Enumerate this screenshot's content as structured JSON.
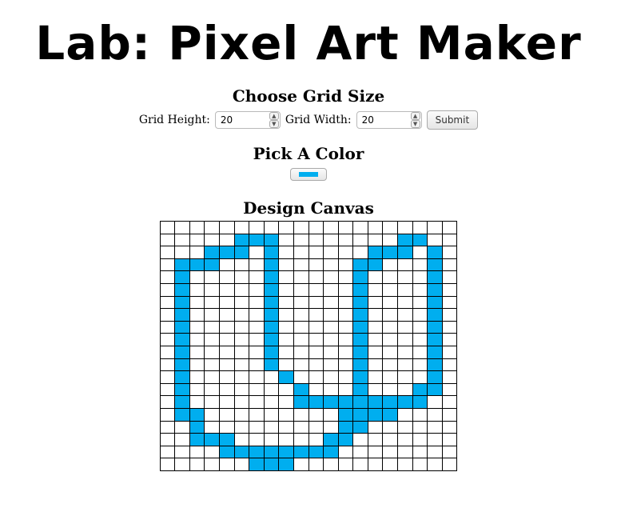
{
  "page": {
    "title": "Lab: Pixel Art Maker"
  },
  "grid_size": {
    "heading": "Choose Grid Size",
    "height_label": "Grid Height:",
    "height_value": "20",
    "width_label": "Grid Width:",
    "width_value": "20",
    "submit_label": "Submit"
  },
  "color": {
    "heading": "Pick A Color",
    "selected": "#00aeef"
  },
  "canvas": {
    "heading": "Design Canvas",
    "rows": 20,
    "cols": 20,
    "empty_color": "#ffffff",
    "fill_color": "#00aeef",
    "filled_cells": [
      [
        1,
        5
      ],
      [
        1,
        6
      ],
      [
        1,
        7
      ],
      [
        1,
        16
      ],
      [
        1,
        17
      ],
      [
        2,
        3
      ],
      [
        2,
        4
      ],
      [
        2,
        5
      ],
      [
        2,
        7
      ],
      [
        2,
        14
      ],
      [
        2,
        15
      ],
      [
        2,
        16
      ],
      [
        2,
        18
      ],
      [
        3,
        1
      ],
      [
        3,
        2
      ],
      [
        3,
        3
      ],
      [
        3,
        7
      ],
      [
        3,
        13
      ],
      [
        3,
        14
      ],
      [
        3,
        18
      ],
      [
        4,
        1
      ],
      [
        4,
        7
      ],
      [
        4,
        13
      ],
      [
        4,
        18
      ],
      [
        5,
        1
      ],
      [
        5,
        7
      ],
      [
        5,
        13
      ],
      [
        5,
        18
      ],
      [
        6,
        1
      ],
      [
        6,
        7
      ],
      [
        6,
        13
      ],
      [
        6,
        18
      ],
      [
        7,
        1
      ],
      [
        7,
        7
      ],
      [
        7,
        13
      ],
      [
        7,
        18
      ],
      [
        8,
        1
      ],
      [
        8,
        7
      ],
      [
        8,
        13
      ],
      [
        8,
        18
      ],
      [
        9,
        1
      ],
      [
        9,
        7
      ],
      [
        9,
        13
      ],
      [
        9,
        18
      ],
      [
        10,
        1
      ],
      [
        10,
        7
      ],
      [
        10,
        13
      ],
      [
        10,
        18
      ],
      [
        11,
        1
      ],
      [
        11,
        7
      ],
      [
        11,
        13
      ],
      [
        11,
        18
      ],
      [
        12,
        1
      ],
      [
        12,
        8
      ],
      [
        12,
        13
      ],
      [
        12,
        18
      ],
      [
        13,
        1
      ],
      [
        13,
        9
      ],
      [
        13,
        13
      ],
      [
        13,
        17
      ],
      [
        13,
        18
      ],
      [
        14,
        1
      ],
      [
        14,
        9
      ],
      [
        14,
        10
      ],
      [
        14,
        11
      ],
      [
        14,
        12
      ],
      [
        14,
        13
      ],
      [
        14,
        14
      ],
      [
        14,
        15
      ],
      [
        14,
        16
      ],
      [
        14,
        17
      ],
      [
        15,
        1
      ],
      [
        15,
        2
      ],
      [
        15,
        12
      ],
      [
        15,
        13
      ],
      [
        15,
        14
      ],
      [
        15,
        15
      ],
      [
        16,
        2
      ],
      [
        16,
        12
      ],
      [
        16,
        13
      ],
      [
        17,
        2
      ],
      [
        17,
        3
      ],
      [
        17,
        4
      ],
      [
        17,
        11
      ],
      [
        17,
        12
      ],
      [
        18,
        4
      ],
      [
        18,
        5
      ],
      [
        18,
        6
      ],
      [
        18,
        7
      ],
      [
        18,
        8
      ],
      [
        18,
        9
      ],
      [
        18,
        10
      ],
      [
        18,
        11
      ],
      [
        19,
        6
      ],
      [
        19,
        7
      ],
      [
        19,
        8
      ]
    ]
  }
}
